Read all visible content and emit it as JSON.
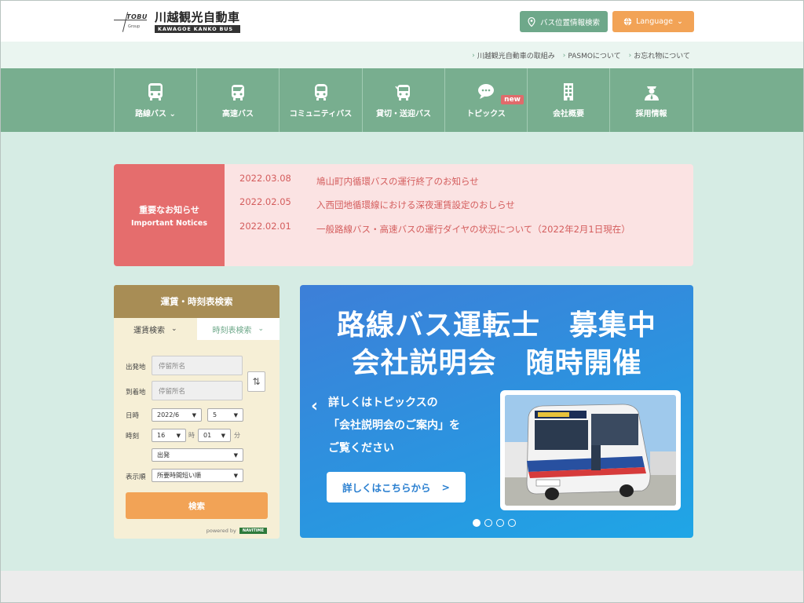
{
  "header": {
    "logo_mark_text": "TOBU",
    "logo_mark_sub": "Group",
    "logo_jp": "川越観光自動車",
    "logo_en": "KAWAGOE KANKO BUS",
    "bus_location_button": "バス位置情報検索",
    "language_button": "Language"
  },
  "sublinks": [
    {
      "label": "川越観光自動車の取組み"
    },
    {
      "label": "PASMOについて"
    },
    {
      "label": "お忘れ物について"
    }
  ],
  "nav": {
    "items": [
      {
        "label": "路線バス",
        "icon": "bus-icon"
      },
      {
        "label": "高速バス",
        "icon": "highway-bus-icon"
      },
      {
        "label": "コミュニティバス",
        "icon": "community-bus-icon"
      },
      {
        "label": "貸切・送迎バス",
        "icon": "charter-bus-icon"
      },
      {
        "label": "トピックス",
        "icon": "speech-bubble-icon",
        "badge": "new"
      },
      {
        "label": "会社概要",
        "icon": "building-icon"
      },
      {
        "label": "採用情報",
        "icon": "person-icon"
      }
    ]
  },
  "notices": {
    "label_jp": "重要なお知らせ",
    "label_en": "Important Notices",
    "items": [
      {
        "date": "2022.03.08",
        "title": "鳩山町内循環バスの運行終了のお知らせ"
      },
      {
        "date": "2022.02.05",
        "title": "入西団地循環線における深夜運賃設定のおしらせ"
      },
      {
        "date": "2022.02.01",
        "title": "一般路線バス・高速バスの運行ダイヤの状況について（2022年2月1日現在）"
      }
    ]
  },
  "search": {
    "title": "運賃・時刻表検索",
    "tabs": [
      {
        "label": "運賃検索",
        "active": false
      },
      {
        "label": "時刻表検索",
        "active": true
      }
    ],
    "departure_label": "出発地",
    "departure_placeholder": "停留所名",
    "arrival_label": "到着地",
    "arrival_placeholder": "停留所名",
    "date_label": "日時",
    "date_month": "2022/6",
    "date_day": "5",
    "time_label": "時刻",
    "hour": "16",
    "hour_unit": "時",
    "minute": "01",
    "minute_unit": "分",
    "mode": "出発",
    "order_label": "表示順",
    "order_value": "所要時間短い順",
    "search_button": "検索",
    "powered_by": "powered by",
    "powered_brand": "NAVITIME"
  },
  "banner": {
    "title_line1": "路線バス運転士　募集中",
    "title_line2": "会社説明会　随時開催",
    "body_line1": "詳しくはトピックスの",
    "body_line2": "「会社説明会のご案内」を",
    "body_line3": "ご覧ください",
    "button_label": "詳しくはこちらから",
    "button_arrow": ">",
    "prev_arrow": "‹",
    "next_arrow": "›",
    "slide_count": 4,
    "active_slide": 1
  },
  "colors": {
    "nav_green": "#78ae8f",
    "notice_red": "#e56d6d",
    "accent_orange": "#f2a356",
    "search_brown": "#a88d55",
    "banner_blue": "#2a95e0"
  }
}
